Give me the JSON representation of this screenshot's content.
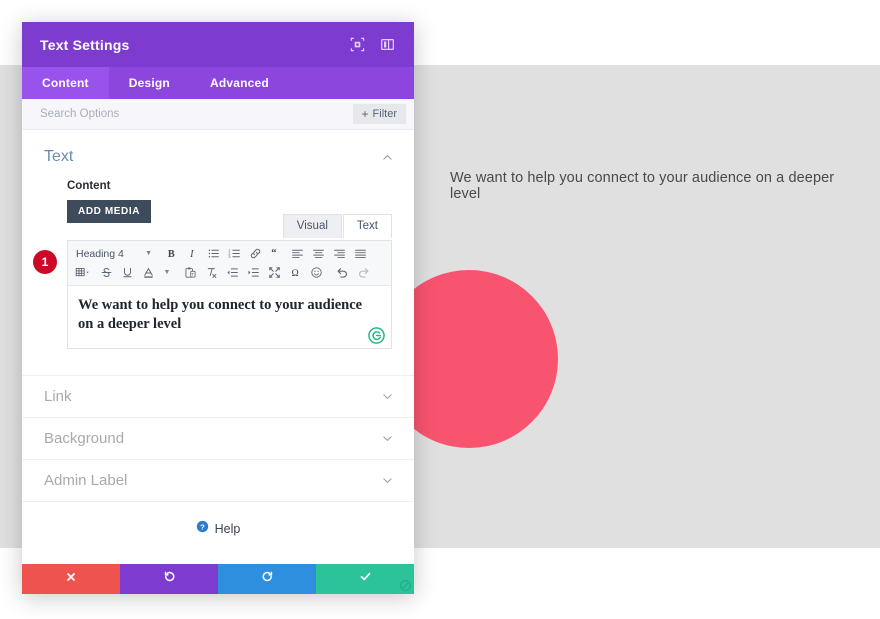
{
  "canvas": {
    "heading_text": "We want to help you connect to your audience on a deeper level",
    "blob_color": "#f9546f",
    "background_color": "#e0e0e0"
  },
  "modal": {
    "title": "Text Settings",
    "header_color": "#7e3bd0",
    "header_icons": [
      {
        "name": "focus-target-icon"
      },
      {
        "name": "panel-layout-icon"
      }
    ],
    "tabs": [
      {
        "label": "Content",
        "active": true
      },
      {
        "label": "Design",
        "active": false
      },
      {
        "label": "Advanced",
        "active": false
      }
    ],
    "search": {
      "placeholder": "Search Options",
      "value": "",
      "filter_label": "Filter",
      "filter_plus": "+"
    },
    "text_section": {
      "title": "Text",
      "expanded": true,
      "content_label": "Content",
      "add_media_label": "ADD MEDIA",
      "editor_tabs": [
        {
          "label": "Visual",
          "active": true
        },
        {
          "label": "Text",
          "active": false
        }
      ],
      "toolbar": {
        "format_select": "Heading 4",
        "row1": [
          "bold-icon",
          "italic-icon",
          "bulleted-list-icon",
          "numbered-list-icon",
          "link-icon",
          "blockquote-icon",
          "align-left-icon",
          "align-center-icon",
          "align-right-icon",
          "align-justify-icon"
        ],
        "row2": [
          "table-icon",
          "strikethrough-icon",
          "underline-icon",
          "text-color-icon",
          "paste-as-text-icon",
          "clear-formatting-icon",
          "outdent-icon",
          "indent-icon",
          "fullscreen-icon",
          "special-character-icon",
          "emoji-icon",
          "undo-icon",
          "redo-icon"
        ]
      },
      "editor_value": "We want to help you connect to your audience on a deeper level",
      "grammarly_icon": "grammarly-g-icon"
    },
    "collapsed_sections": [
      {
        "label": "Link"
      },
      {
        "label": "Background"
      },
      {
        "label": "Admin Label"
      }
    ],
    "help_label": "Help",
    "footer_buttons": [
      {
        "name": "close",
        "icon": "x-icon",
        "color": "#ef5350"
      },
      {
        "name": "undo",
        "icon": "undo-icon",
        "color": "#7e3bd0"
      },
      {
        "name": "redo",
        "icon": "redo-icon",
        "color": "#2d8fdd"
      },
      {
        "name": "save",
        "icon": "check-icon",
        "color": "#2cc39b"
      }
    ]
  },
  "callout": {
    "number": "1",
    "color": "#cc0a27"
  }
}
